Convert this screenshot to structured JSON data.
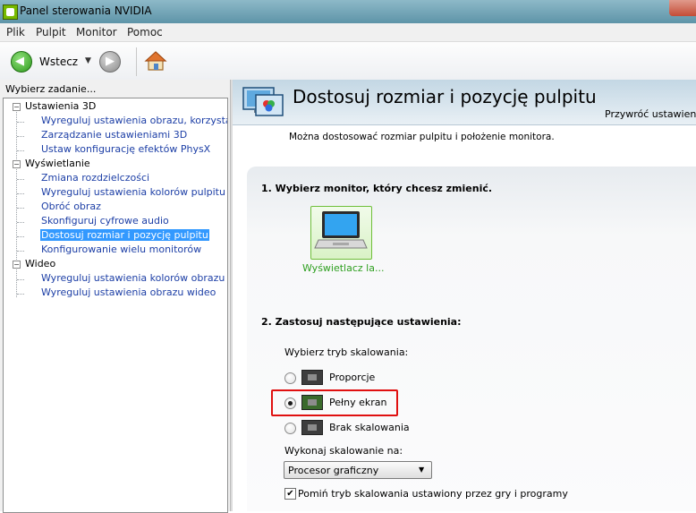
{
  "window": {
    "title": "Panel sterowania NVIDIA"
  },
  "menu": [
    "Plik",
    "Pulpit",
    "Monitor",
    "Pomoc"
  ],
  "toolbar": {
    "back_label": "Wstecz"
  },
  "left_pane": {
    "label": "Wybierz zadanie...",
    "tree": [
      {
        "label": "Ustawienia 3D",
        "children": [
          "Wyreguluj ustawienia obrazu, korzystając z",
          "Zarządzanie ustawieniami 3D",
          "Ustaw konfigurację efektów PhysX"
        ]
      },
      {
        "label": "Wyświetlanie",
        "children": [
          "Zmiana rozdzielczości",
          "Wyreguluj ustawienia kolorów pulpitu",
          "Obróć obraz",
          "Skonfiguruj cyfrowe audio",
          "Dostosuj rozmiar i pozycję pulpitu",
          "Konfigurowanie wielu monitorów"
        ]
      },
      {
        "label": "Wideo",
        "children": [
          "Wyreguluj ustawienia kolorów obrazu wideo",
          "Wyreguluj ustawienia obrazu wideo"
        ]
      }
    ],
    "selected": "Dostosuj rozmiar i pozycję pulpitu"
  },
  "page": {
    "title": "Dostosuj rozmiar i pozycję pulpitu",
    "restore_link": "Przywróć ustawienia",
    "description": "Można dostosować rozmiar pulpitu i położenie monitora.",
    "step1": "1. Wybierz monitor, który chcesz zmienić.",
    "monitor_label": "Wyświetlacz la...",
    "step2": "2. Zastosuj następujące ustawienia:",
    "scaling_mode_label": "Wybierz tryb skalowania:",
    "scaling_options": [
      "Proporcje",
      "Pełny ekran",
      "Brak skalowania"
    ],
    "scaling_selected": "Pełny ekran",
    "perform_scaling_label": "Wykonaj skalowanie na:",
    "perform_scaling_value": "Procesor graficzny",
    "override_checkbox_label": "Pomiń tryb skalowania ustawiony przez gry i programy",
    "override_checked": true
  },
  "colors": {
    "highlight_box": "#e01010",
    "tree_link": "#1d3fa6",
    "monitor_label": "#2e9f1f",
    "selection": "#3399ff"
  }
}
